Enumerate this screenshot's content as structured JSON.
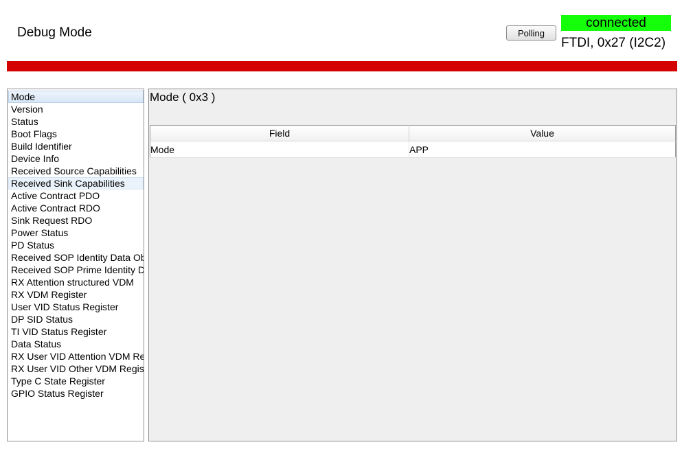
{
  "header": {
    "title": "Debug Mode",
    "polling_label": "Polling",
    "status": "connected",
    "connection": "FTDI, 0x27 (I2C2)",
    "status_color": "#16ff0a",
    "bar_color": "#d50000"
  },
  "sidebar": {
    "selected_index": 0,
    "hover_index": 7,
    "items": [
      {
        "label": "Mode"
      },
      {
        "label": "Version"
      },
      {
        "label": "Status"
      },
      {
        "label": "Boot Flags"
      },
      {
        "label": "Build Identifier"
      },
      {
        "label": "Device Info"
      },
      {
        "label": "Received Source Capabilities"
      },
      {
        "label": "Received Sink Capabilities"
      },
      {
        "label": "Active Contract PDO"
      },
      {
        "label": "Active Contract RDO"
      },
      {
        "label": "Sink Request RDO"
      },
      {
        "label": "Power Status"
      },
      {
        "label": "PD Status"
      },
      {
        "label": "Received SOP Identity Data Ob"
      },
      {
        "label": "Received SOP Prime Identity D"
      },
      {
        "label": "RX Attention structured VDM"
      },
      {
        "label": "RX VDM Register"
      },
      {
        "label": "User VID Status Register"
      },
      {
        "label": "DP SID Status"
      },
      {
        "label": "TI VID Status Register"
      },
      {
        "label": "Data Status"
      },
      {
        "label": "RX User VID Attention VDM Re"
      },
      {
        "label": "RX User VID Other VDM Regist"
      },
      {
        "label": "Type C State Register"
      },
      {
        "label": "GPIO Status Register"
      }
    ]
  },
  "main": {
    "title": "Mode  ( 0x3 )",
    "table": {
      "headers": [
        "Field",
        "Value"
      ],
      "rows": [
        [
          "Mode",
          "APP"
        ]
      ]
    }
  }
}
